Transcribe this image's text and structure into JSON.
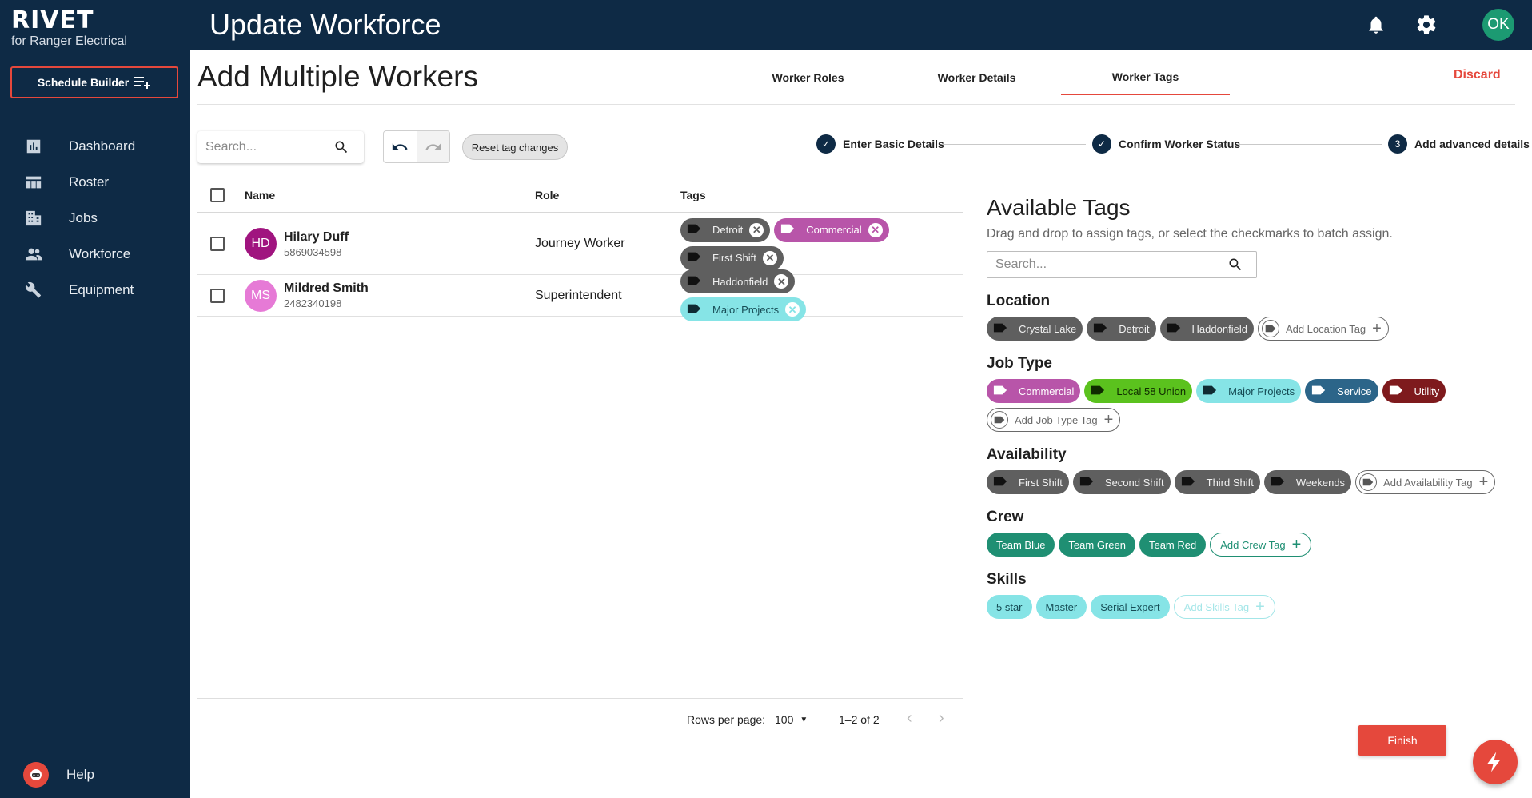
{
  "brand": {
    "name": "RIVET",
    "subtitle": "for Ranger Electrical"
  },
  "sidebar": {
    "schedule_builder": "Schedule Builder",
    "items": [
      {
        "label": "Dashboard",
        "icon": "dashboard-icon"
      },
      {
        "label": "Roster",
        "icon": "roster-icon"
      },
      {
        "label": "Jobs",
        "icon": "jobs-icon"
      },
      {
        "label": "Workforce",
        "icon": "workforce-icon"
      },
      {
        "label": "Equipment",
        "icon": "wrench-icon"
      }
    ],
    "help": "Help"
  },
  "topbar": {
    "title": "Update Workforce",
    "avatar_initials": "OK"
  },
  "page": {
    "title": "Add Multiple Workers",
    "discard": "Discard"
  },
  "tabs": [
    {
      "label": "Worker Roles",
      "active": false
    },
    {
      "label": "Worker Details",
      "active": false
    },
    {
      "label": "Worker Tags",
      "active": true
    }
  ],
  "toolbar": {
    "search_placeholder": "Search...",
    "reset_label": "Reset tag changes"
  },
  "stepper": [
    {
      "label": "Enter Basic Details",
      "state": "done"
    },
    {
      "label": "Confirm Worker Status",
      "state": "done"
    },
    {
      "label": "Add advanced details",
      "state": "current",
      "number": "3"
    }
  ],
  "table": {
    "headers": {
      "name": "Name",
      "role": "Role",
      "tags": "Tags"
    },
    "rows": [
      {
        "initials": "HD",
        "avatar_color": "#a0147f",
        "name": "Hilary Duff",
        "phone": "5869034598",
        "role": "Journey Worker",
        "tags": [
          {
            "label": "Detroit",
            "style": "gray"
          },
          {
            "label": "Commercial",
            "style": "purple"
          },
          {
            "label": "First Shift",
            "style": "gray"
          }
        ]
      },
      {
        "initials": "MS",
        "avatar_color": "#e67ad6",
        "name": "Mildred Smith",
        "phone": "2482340198",
        "role": "Superintendent",
        "tags": [
          {
            "label": "Haddonfield",
            "style": "gray"
          },
          {
            "label": "Major Projects",
            "style": "cyan"
          }
        ]
      }
    ]
  },
  "pagination": {
    "rows_per_page_label": "Rows per page:",
    "rows_per_page": "100",
    "range": "1–2 of 2"
  },
  "available": {
    "title": "Available Tags",
    "subtitle": "Drag and drop to assign tags, or select the checkmarks to batch assign.",
    "search_placeholder": "Search...",
    "groups": [
      {
        "title": "Location",
        "chips": [
          {
            "label": "Crystal Lake",
            "style": "gray"
          },
          {
            "label": "Detroit",
            "style": "gray"
          },
          {
            "label": "Haddonfield",
            "style": "gray"
          },
          {
            "label": "Add Location Tag",
            "style": "add"
          }
        ]
      },
      {
        "title": "Job Type",
        "chips": [
          {
            "label": "Commercial",
            "style": "purple"
          },
          {
            "label": "Local 58 Union",
            "style": "green"
          },
          {
            "label": "Major Projects",
            "style": "cyan"
          },
          {
            "label": "Service",
            "style": "blue"
          },
          {
            "label": "Utility",
            "style": "maroon"
          },
          {
            "label": "Add Job Type Tag",
            "style": "add"
          }
        ]
      },
      {
        "title": "Availability",
        "chips": [
          {
            "label": "First Shift",
            "style": "gray"
          },
          {
            "label": "Second Shift",
            "style": "gray"
          },
          {
            "label": "Third Shift",
            "style": "gray"
          },
          {
            "label": "Weekends",
            "style": "gray"
          },
          {
            "label": "Add Availability Tag",
            "style": "add"
          }
        ]
      },
      {
        "title": "Crew",
        "chips": [
          {
            "label": "Team Blue",
            "style": "teal",
            "noicon": true
          },
          {
            "label": "Team Green",
            "style": "teal",
            "noicon": true
          },
          {
            "label": "Team Red",
            "style": "teal",
            "noicon": true
          },
          {
            "label": "Add Crew Tag",
            "style": "add-teal",
            "noicon": true
          }
        ]
      },
      {
        "title": "Skills",
        "chips": [
          {
            "label": "5 star",
            "style": "cyan",
            "noicon": true
          },
          {
            "label": "Master",
            "style": "cyan",
            "noicon": true
          },
          {
            "label": "Serial Expert",
            "style": "cyan",
            "noicon": true
          },
          {
            "label": "Add Skills Tag",
            "style": "add-cyan",
            "noicon": true
          }
        ]
      }
    ]
  },
  "finish_label": "Finish",
  "colors": {
    "navy": "#0e2a45",
    "accent": "#e5483c",
    "teal": "#1f8f73"
  }
}
